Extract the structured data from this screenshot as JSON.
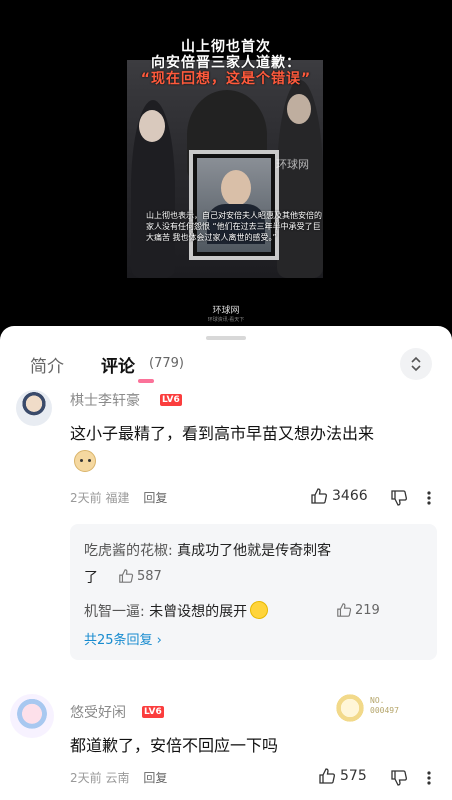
{
  "video": {
    "title_line1": "山上彻也首次",
    "title_line2": "向安倍晋三家人道歉：",
    "title_line3": "“现在回想，这是个错误”",
    "watermark": "环球网",
    "caption": "山上彻也表示，自己对安倍夫人昭惠及其他安倍的家人没有任何怨恨 “他们在过去三年半中承受了巨大痛苦 我也体会过家人离世的感受。”",
    "brand": "环球网",
    "brand_sub": "环球资讯·看天下"
  },
  "tabs": {
    "intro": "简介",
    "comments": "评论",
    "count": "(779)"
  },
  "comments": [
    {
      "username": "棋士李轩豪",
      "level": "LV6",
      "text": "这小子最精了，看到高市早苗又想办法出来",
      "time": "2天前",
      "location": "福建",
      "reply_label": "回复",
      "likes": "3466",
      "replies": [
        {
          "name": "吃虎酱的花椒:",
          "text": "真成功了他就是传奇刺客",
          "text2": "了",
          "likes": "587"
        },
        {
          "name": "机智一逼:",
          "text": "未曾设想的展开",
          "likes": "219"
        }
      ],
      "see_more": "共25条回复 ›"
    },
    {
      "username": "悠受好闲",
      "level": "LV6",
      "text": "都道歉了，安倍不回应一下吗",
      "time": "2天前",
      "location": "云南",
      "reply_label": "回复",
      "likes": "575",
      "badge_no": "NO.\n000497"
    }
  ],
  "icons": {
    "sort": "sort-toggle-icon",
    "like": "thumb-up-icon",
    "dislike": "thumb-down-icon",
    "more": "more-vertical-icon"
  },
  "colors": {
    "accent_pink": "#fb7299",
    "level_red": "#fb3d3d",
    "link_blue": "#178bcf",
    "title_orange": "#ff5a3c"
  }
}
